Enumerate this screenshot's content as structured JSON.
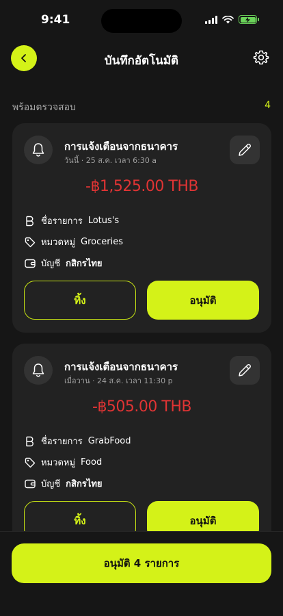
{
  "status_bar": {
    "time": "9:41"
  },
  "nav": {
    "title": "บันทึกอัตโนมัติ"
  },
  "section": {
    "title": "พร้อมตรวจสอบ",
    "count": "4"
  },
  "cards": [
    {
      "title": "การแจ้งเตือนจากธนาคาร",
      "subtitle": "วันนี้ · 25 ส.ค. เวลา 6:30 a",
      "amount": "-฿1,525.00 THB",
      "merchant_label": "ชื่อรายการ",
      "merchant": "Lotus's",
      "category_label": "หมวดหมู่",
      "category": "Groceries",
      "account_label": "บัญชี",
      "account": "กสิกรไทย",
      "discard_label": "ทิ้ง",
      "approve_label": "อนุมัติ"
    },
    {
      "title": "การแจ้งเตือนจากธนาคาร",
      "subtitle": "เมื่อวาน · 24 ส.ค. เวลา 11:30 p",
      "amount": "-฿505.00 THB",
      "merchant_label": "ชื่อรายการ",
      "merchant": "GrabFood",
      "category_label": "หมวดหมู่",
      "category": "Food",
      "account_label": "บัญชี",
      "account": "กสิกรไทย",
      "discard_label": "ทิ้ง",
      "approve_label": "อนุมัติ"
    }
  ],
  "footer": {
    "approve_all_label": "อนุมัติ 4 รายการ"
  },
  "colors": {
    "accent": "#d4f218",
    "negative": "#e03434",
    "background": "#161616",
    "card": "#222222"
  },
  "icons": [
    "back-arrow-icon",
    "gear-icon",
    "bell-icon",
    "pencil-icon",
    "merchant-icon",
    "tag-icon",
    "wallet-icon",
    "signal-icon",
    "wifi-icon",
    "battery-icon"
  ]
}
